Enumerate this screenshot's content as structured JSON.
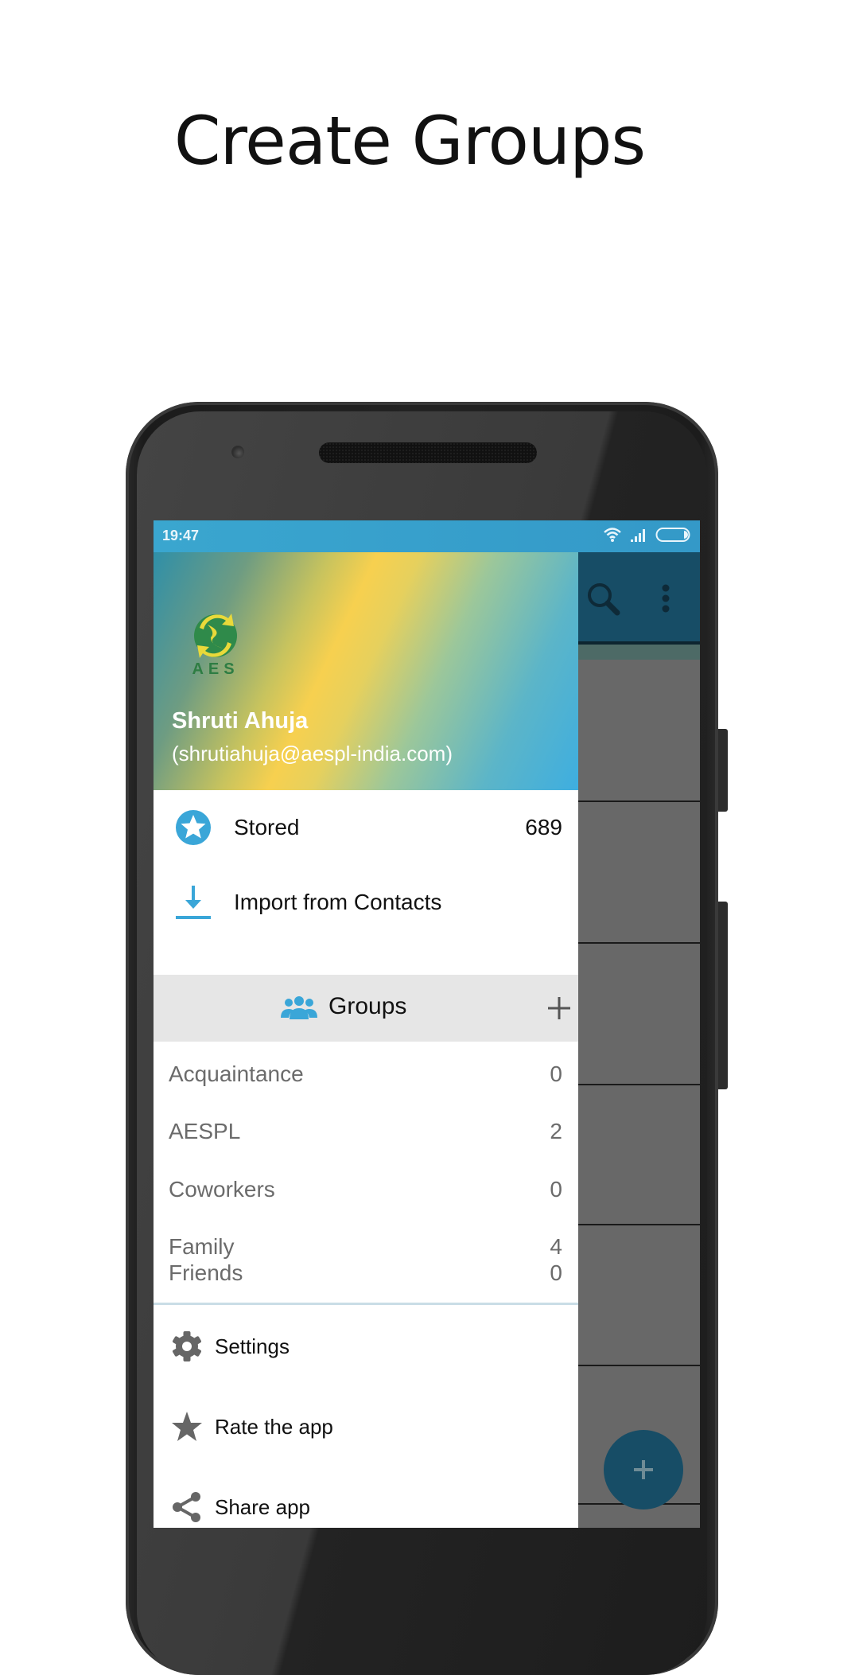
{
  "promo": {
    "title": "Create Groups"
  },
  "status_bar": {
    "time": "19:47",
    "icons": [
      "wifi-icon",
      "signal-icon",
      "battery-icon"
    ]
  },
  "app_bar": {
    "actions": [
      "search-icon",
      "overflow-menu-icon"
    ],
    "fab_icon": "plus-icon"
  },
  "drawer": {
    "logo_text": "AES",
    "user_name": "Shruti Ahuja",
    "user_email": "(shrutiahuja@aespl-india.com)",
    "items": [
      {
        "label": "Stored",
        "count": "689",
        "icon": "star-circle-icon"
      },
      {
        "label": "Import from Contacts",
        "icon": "download-icon"
      }
    ],
    "groups_header": {
      "label": "Groups",
      "icon": "groups-icon",
      "action_icon": "plus-icon"
    },
    "groups": [
      {
        "name": "Acquaintance",
        "count": "0"
      },
      {
        "name": "AESPL",
        "count": "2"
      },
      {
        "name": "Coworkers",
        "count": "0"
      },
      {
        "name": "Family",
        "count": "4"
      },
      {
        "name": "Friends",
        "count": "0"
      }
    ],
    "bottom_items": [
      {
        "label": "Settings",
        "icon": "gear-icon"
      },
      {
        "label": "Rate the app",
        "icon": "star-icon"
      },
      {
        "label": "Share app",
        "icon": "share-icon"
      }
    ]
  },
  "colors": {
    "accent": "#3aa6d8",
    "app_bar": "#174d66",
    "status_bar": "#3aa6cf",
    "group_text": "#6b6b6b"
  }
}
